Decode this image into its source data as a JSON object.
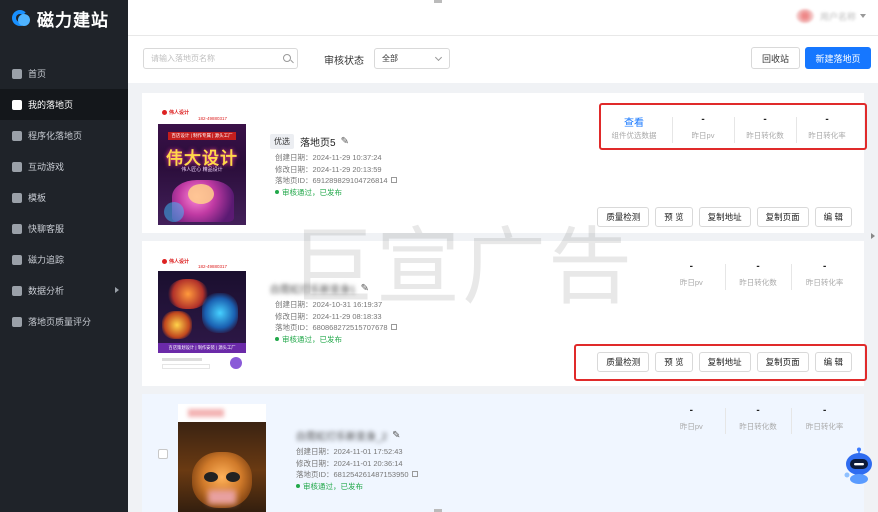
{
  "app": {
    "name": "磁力建站"
  },
  "user": {
    "name": "用户名称"
  },
  "sidebar": {
    "items": [
      {
        "label": "首页",
        "icon": "home-icon"
      },
      {
        "label": "我的落地页",
        "icon": "document-icon",
        "active": true
      },
      {
        "label": "程序化落地页",
        "icon": "program-icon"
      },
      {
        "label": "互动游戏",
        "icon": "game-icon"
      },
      {
        "label": "模板",
        "icon": "template-icon"
      },
      {
        "label": "快聊客服",
        "icon": "chat-icon"
      },
      {
        "label": "磁力追踪",
        "icon": "track-icon"
      },
      {
        "label": "数据分析",
        "icon": "chart-icon",
        "has_submenu": true
      },
      {
        "label": "落地页质量评分",
        "icon": "monitor-icon"
      }
    ]
  },
  "filter": {
    "search_placeholder": "请输入落地页名称",
    "status_label": "审核状态",
    "status_value": "全部",
    "recycle_label": "回收站",
    "new_label": "新建落地页"
  },
  "cards": [
    {
      "badge": "优选",
      "title": "落地页5",
      "created": "创建日期：2024-11-29 10:37:24",
      "modified": "修改日期：2024-11-29 20:13:59",
      "page_id": "落地页ID：691289829104726814",
      "status": "审核通过，已发布",
      "stats": {
        "view_label": "查看",
        "view_caption": "组件优选数据",
        "pv": "-",
        "pv_label": "昨日pv",
        "conv_count": "-",
        "conv_count_label": "昨日转化数",
        "conv_rate": "-",
        "conv_rate_label": "昨日转化率"
      },
      "actions": [
        "质量检测",
        "预 览",
        "复制地址",
        "复制页面",
        "编 辑"
      ],
      "thumb": {
        "brand": "伟人设计",
        "phone": "182-49880317",
        "slogan": "百店设计 | 制作专属 | 源头工厂",
        "headline": "伟大设计",
        "sub": "伟人匠心 精品设计"
      }
    },
    {
      "title": "白霓虹灯乐新变身1",
      "created": "创建日期：2024-10-31 16:19:37",
      "modified": "修改日期：2024-11-29 08:18:33",
      "page_id": "落地页ID：680868272515707678",
      "status": "审核通过，已发布",
      "stats": {
        "pv": "-",
        "pv_label": "昨日pv",
        "conv_count": "-",
        "conv_count_label": "昨日转化数",
        "conv_rate": "-",
        "conv_rate_label": "昨日转化率"
      },
      "actions": [
        "质量检测",
        "预 览",
        "复制地址",
        "复制页面",
        "编 辑"
      ],
      "thumb": {
        "brand": "伟人设计",
        "phone": "182-49880317",
        "footer": "百店策划设计 | 制作安装 | 源头工厂"
      }
    },
    {
      "title": "白霓虹灯乐新变身_2",
      "created": "创建日期：2024-11-01 17:52:43",
      "modified": "修改日期：2024-11-01 20:36:14",
      "page_id": "落地页ID：681254261487153950",
      "status": "审核通过，已发布",
      "stats": {
        "pv": "-",
        "pv_label": "昨日pv",
        "conv_count": "-",
        "conv_count_label": "昨日转化数",
        "conv_rate": "-",
        "conv_rate_label": "昨日转化率"
      }
    }
  ],
  "watermark": "巨宣广告",
  "colors": {
    "primary": "#1677ff",
    "sidebar_bg": "#1f2329",
    "highlight": "#e02a2a",
    "success": "#22a84a"
  }
}
